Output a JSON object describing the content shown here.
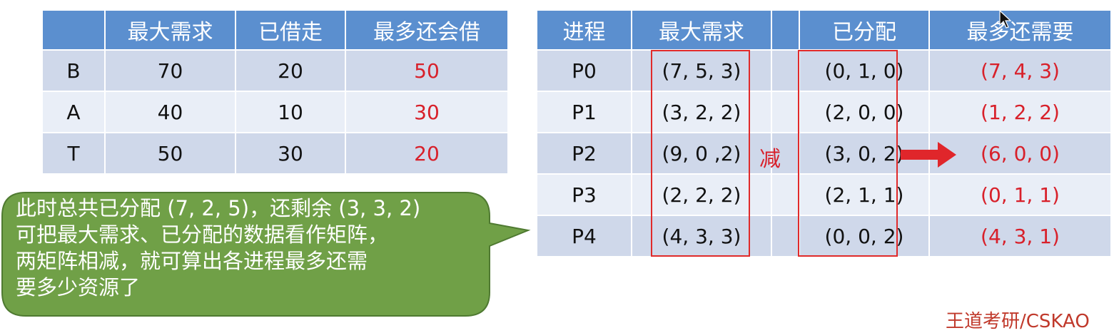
{
  "table1": {
    "headers": [
      "",
      "最大需求",
      "已借走",
      "最多还会借"
    ],
    "rows": [
      [
        "B",
        "70",
        "20",
        "50"
      ],
      [
        "A",
        "40",
        "10",
        "30"
      ],
      [
        "T",
        "50",
        "30",
        "20"
      ]
    ]
  },
  "table2": {
    "headers": [
      "进程",
      "最大需求",
      "",
      "已分配",
      "最多还需要"
    ],
    "rows": [
      [
        "P0",
        "(7, 5, 3)",
        "",
        "(0, 1, 0)",
        "(7, 4, 3)"
      ],
      [
        "P1",
        "(3, 2, 2)",
        "",
        "(2, 0, 0)",
        "(1, 2, 2)"
      ],
      [
        "P2",
        "(9, 0 ,2)",
        "",
        "(3, 0, 2)",
        "(6, 0, 0)"
      ],
      [
        "P3",
        "(2, 2, 2)",
        "",
        "(2, 1, 1)",
        "(0, 1, 1)"
      ],
      [
        "P4",
        "(4, 3, 3)",
        "",
        "(0, 0, 2)",
        "(4, 3, 1)"
      ]
    ],
    "minus_label": "减"
  },
  "callout": {
    "text": "此时总共已分配 (7, 2, 5)，还剩余 (3, 3, 2)\n可把最大需求、已分配的数据看作矩阵，\n两矩阵相减，就可算出各进程最多还需\n要多少资源了"
  },
  "watermark": "王道考研/CSKAO",
  "colors": {
    "header_blue": "#5b8fcf",
    "row_dark": "#cfd8ea",
    "row_light": "#e9eef7",
    "accent_red": "#d8202a",
    "callout_green": "#70a047"
  },
  "icons": {
    "arrow": "right-arrow-icon",
    "cursor": "mouse-cursor-icon"
  }
}
